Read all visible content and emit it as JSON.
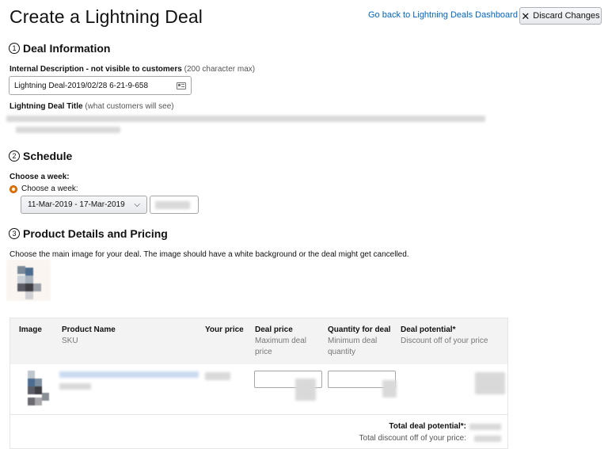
{
  "page_title": "Create a Lightning Deal",
  "header": {
    "dashboard_link": "Go back to Lightning Deals Dashboard",
    "discard_label": "Discard Changes",
    "discard_icon": "close-icon"
  },
  "deal_info": {
    "number": "1",
    "heading": "Deal Information",
    "internal_desc_label": "Internal Description - not visible to customers",
    "internal_desc_hint": "(200 character max)",
    "internal_desc_value": "Lightning Deal-2019/02/28 6-21-9-658",
    "title_label": "Lightning Deal Title",
    "title_hint": "(what customers will see)"
  },
  "schedule": {
    "number": "2",
    "heading": "Schedule",
    "choose_week_label": "Choose a week:",
    "radio_label": "Choose a week:",
    "week_value": "11-Mar-2019 - 17-Mar-2019"
  },
  "product": {
    "number": "3",
    "heading": "Product Details and Pricing",
    "instructions": "Choose the main image for your deal. The image should have a white background or the deal might get cancelled."
  },
  "table": {
    "headers": [
      {
        "title": "Image",
        "sub": ""
      },
      {
        "title": "Product Name",
        "sub": "SKU"
      },
      {
        "title": "Your price",
        "sub": ""
      },
      {
        "title": "Deal price",
        "sub": "Maximum deal price"
      },
      {
        "title": "Quantity for deal",
        "sub": "Minimum deal quantity"
      },
      {
        "title": "Deal potential*",
        "sub": "Discount off of your price"
      }
    ],
    "total_label": "Total deal potential*:",
    "total_discount_label": "Total discount off of your price:"
  },
  "colors": {
    "link": "#0066c0",
    "radio": "#e77600",
    "table_header_bg": "#f3f3f3"
  }
}
